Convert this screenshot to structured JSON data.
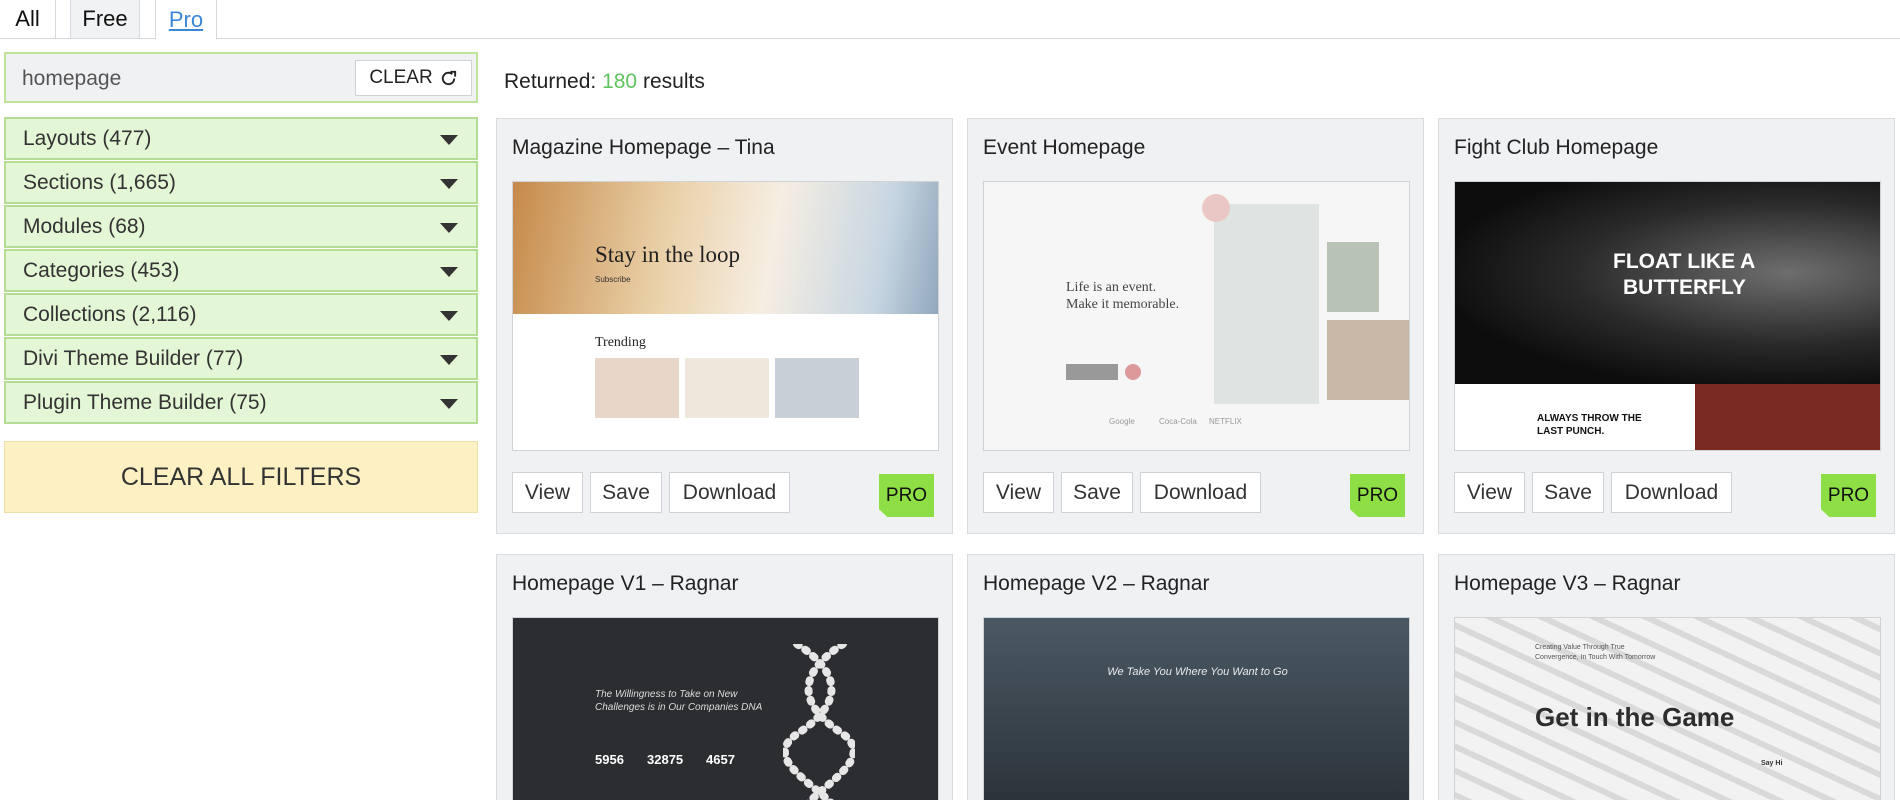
{
  "tabs": [
    {
      "label": "All"
    },
    {
      "label": "Free"
    },
    {
      "label": "Pro"
    }
  ],
  "search": {
    "value": "homepage",
    "clear_label": "CLEAR"
  },
  "filters": [
    {
      "label": "Layouts (477)"
    },
    {
      "label": "Sections (1,665)"
    },
    {
      "label": "Modules (68)"
    },
    {
      "label": "Categories (453)"
    },
    {
      "label": "Collections (2,116)"
    },
    {
      "label": "Divi Theme Builder (77)"
    },
    {
      "label": "Plugin Theme Builder (75)"
    }
  ],
  "clear_all_label": "CLEAR ALL FILTERS",
  "results": {
    "prefix": "Returned:",
    "count": "180",
    "suffix": "results"
  },
  "card_buttons": {
    "view": "View",
    "save": "Save",
    "download": "Download",
    "badge": "PRO"
  },
  "cards": [
    {
      "title": "Magazine Homepage – Tina",
      "thumb": {
        "headline": "Stay in the loop",
        "subscribe": "Subscribe",
        "section": "Trending"
      }
    },
    {
      "title": "Event Homepage",
      "thumb": {
        "headline_1": "Life is an event.",
        "headline_2": "Make it memorable.",
        "logos": [
          "Google",
          "Coca-Cola",
          "NETFLIX"
        ]
      }
    },
    {
      "title": "Fight Club Homepage",
      "thumb": {
        "headline_1": "FLOAT LIKE A",
        "headline_2": "BUTTERFLY",
        "tagline_1": "ALWAYS THROW THE",
        "tagline_2": "LAST PUNCH."
      }
    },
    {
      "title": "Homepage V1 – Ragnar",
      "thumb": {
        "line_1": "The Willingness to Take on New",
        "line_2": "Challenges is in Our Companies DNA",
        "stats": [
          "5956",
          "32875",
          "4657"
        ]
      }
    },
    {
      "title": "Homepage V2 – Ragnar",
      "thumb": {
        "headline": "We Take You Where You Want to Go"
      }
    },
    {
      "title": "Homepage V3 – Ragnar",
      "thumb": {
        "small_1": "Creating Value Through True",
        "small_2": "Convergence, In Touch With Tomorrow",
        "headline": "Get in the Game",
        "cta": "Say Hi"
      }
    }
  ],
  "colors": {
    "accent_green": "#8ddf45",
    "filter_bg": "#e3f6d6",
    "clear_all_bg": "#fdf1c4",
    "tab_active": "#3b87d6",
    "count_green": "#5fc45f"
  }
}
